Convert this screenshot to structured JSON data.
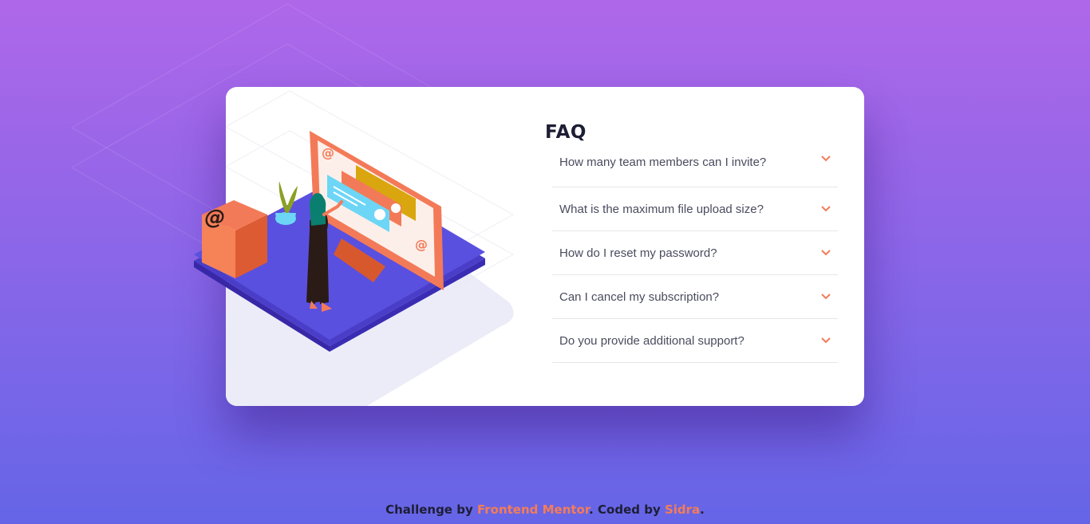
{
  "faq": {
    "title": "FAQ",
    "questions": [
      {
        "text": "How many team members can I invite?",
        "expanded": false
      },
      {
        "text": "What is the maximum file upload size?",
        "expanded": false
      },
      {
        "text": "How do I reset my password?",
        "expanded": false
      },
      {
        "text": "Can I cancel my subscription?",
        "expanded": false
      },
      {
        "text": "Do you provide additional support?",
        "expanded": false
      }
    ],
    "chevron_icon": "chevron-down-icon"
  },
  "footer": {
    "prefix": "Challenge by ",
    "link1": "Frontend Mentor",
    "middle": ". Coded by ",
    "link2": "Sidra",
    "suffix": "."
  },
  "colors": {
    "accent": "#f47c57",
    "title": "#1d1e35",
    "question": "#4a4b5e",
    "gradient_top": "#af67e9",
    "gradient_bottom": "#6565e7"
  }
}
